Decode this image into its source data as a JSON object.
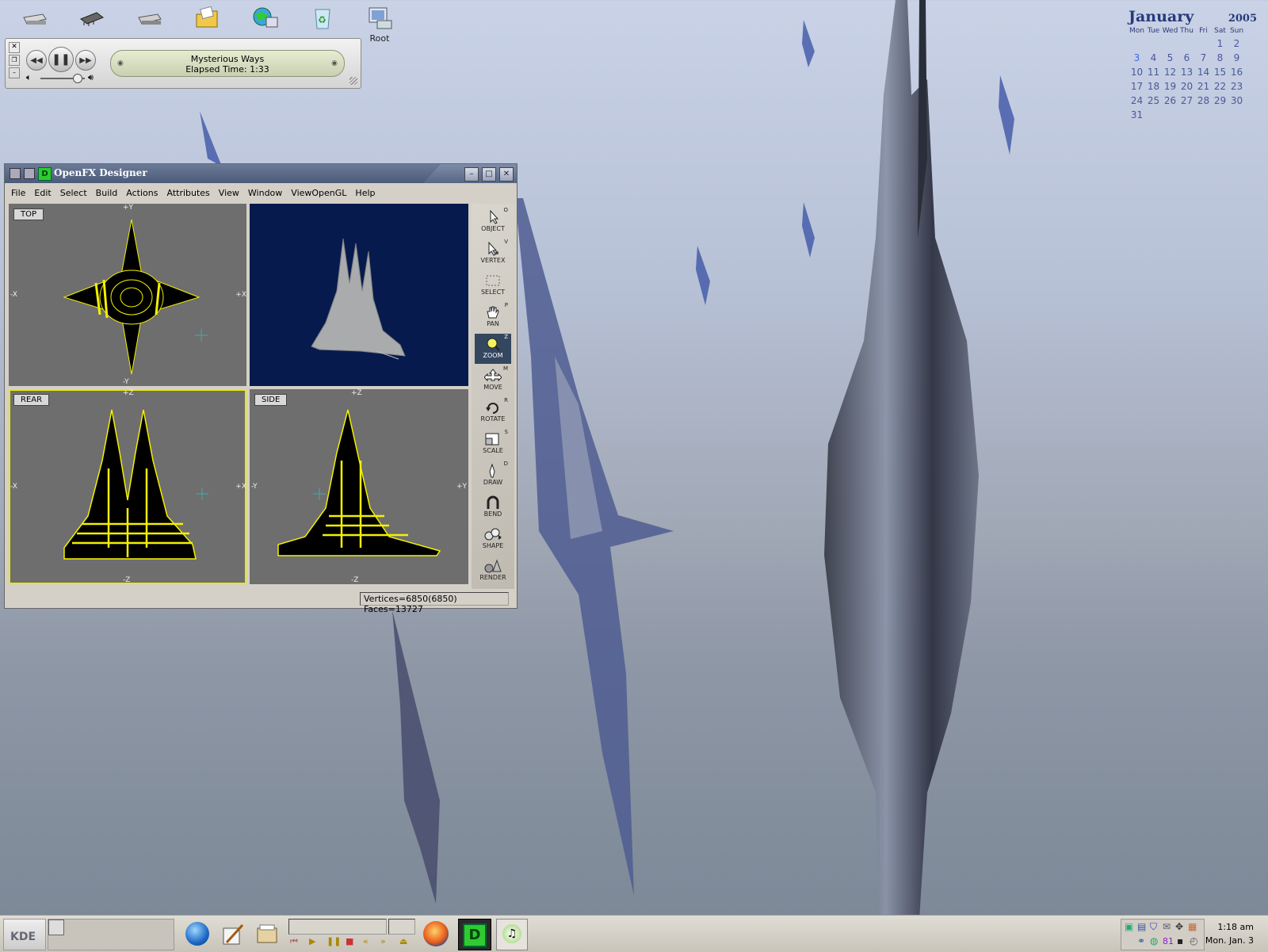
{
  "desktop": {
    "icons": [
      {
        "name": "drive-icon",
        "label": ""
      },
      {
        "name": "memory-chip-icon",
        "label": ""
      },
      {
        "name": "disk-drive-icon",
        "label": ""
      },
      {
        "name": "folder-icon",
        "label": ""
      },
      {
        "name": "network-computer-icon",
        "label": ""
      },
      {
        "name": "recycle-bin-icon",
        "label": ""
      },
      {
        "name": "root-computer-icon",
        "label": "Root"
      }
    ]
  },
  "calendar": {
    "month": "January",
    "year": "2005",
    "weekdays": [
      "Mon",
      "Tue",
      "Wed",
      "Thu",
      "Fri",
      "Sat",
      "Sun"
    ],
    "weeks": [
      [
        "",
        "",
        "",
        "",
        "",
        "1",
        "2"
      ],
      [
        "3",
        "4",
        "5",
        "6",
        "7",
        "8",
        "9"
      ],
      [
        "10",
        "11",
        "12",
        "13",
        "14",
        "15",
        "16"
      ],
      [
        "17",
        "18",
        "19",
        "20",
        "21",
        "22",
        "23"
      ],
      [
        "24",
        "25",
        "26",
        "27",
        "28",
        "29",
        "30"
      ],
      [
        "31",
        "",
        "",
        "",
        "",
        "",
        ""
      ]
    ],
    "today": "3"
  },
  "player": {
    "track": "Mysterious Ways",
    "elapsed": "Elapsed Time: 1:33",
    "volume": 0.82
  },
  "ofx": {
    "title": "OpenFX Designer",
    "menu": [
      "File",
      "Edit",
      "Select",
      "Build",
      "Actions",
      "Attributes",
      "View",
      "Window",
      "ViewOpenGL",
      "Help"
    ],
    "viewports": {
      "top": {
        "label": "TOP",
        "up": "+Y",
        "down": "-Y",
        "left": "-X",
        "right": "+X"
      },
      "rear": {
        "label": "REAR",
        "up": "+Z",
        "down": "-Z",
        "left": "-X",
        "right": "+X"
      },
      "side": {
        "label": "SIDE",
        "up": "+Z",
        "down": "-Z",
        "left": "-Y",
        "right": "+Y"
      }
    },
    "tools": [
      {
        "name": "object",
        "label": "OBJECT",
        "key": "O"
      },
      {
        "name": "vertex",
        "label": "VERTEX",
        "key": "V"
      },
      {
        "name": "select",
        "label": "SELECT",
        "key": ""
      },
      {
        "name": "pan",
        "label": "PAN",
        "key": "P"
      },
      {
        "name": "zoom",
        "label": "ZOOM",
        "key": "Z"
      },
      {
        "name": "move",
        "label": "MOVE",
        "key": "M"
      },
      {
        "name": "rotate",
        "label": "ROTATE",
        "key": "R"
      },
      {
        "name": "scale",
        "label": "SCALE",
        "key": "S"
      },
      {
        "name": "draw",
        "label": "DRAW",
        "key": "D"
      },
      {
        "name": "bend",
        "label": "BEND",
        "key": ""
      },
      {
        "name": "shape",
        "label": "SHAPE",
        "key": ""
      },
      {
        "name": "render",
        "label": "RENDER",
        "key": ""
      }
    ],
    "active_tool": "zoom",
    "status": "Vertices=6850(6850) Faces=13727"
  },
  "taskbar": {
    "clock_time": "1:18 am",
    "clock_date": "Mon. Jan. 3",
    "tray_number": "81"
  },
  "colors": {
    "wire": "#f4f000",
    "viewport_bg": "#6e6e6e",
    "perspective_bg": "#071a4e",
    "active_tool": "#34475f"
  }
}
